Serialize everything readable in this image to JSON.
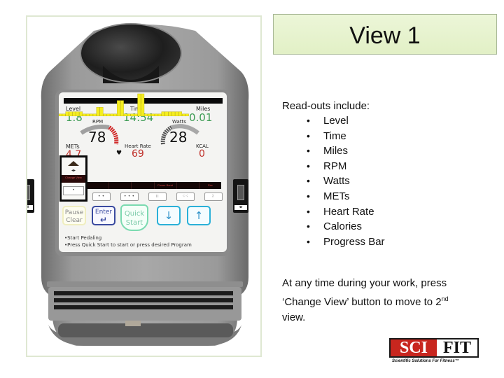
{
  "slide": {
    "title": "View 1",
    "readouts_heading": "Read-outs include:",
    "readouts": [
      "Level",
      "Time",
      "Miles",
      "RPM",
      "Watts",
      "METs",
      "Heart Rate",
      "Calories",
      "Progress Bar"
    ],
    "bullet": "•",
    "note": {
      "part1": "At any time during your work, press ‘Change View’ button to move to 2",
      "superscript": "nd",
      "part2": " view."
    },
    "logo": {
      "sci": "SCI",
      "fit": "FIT",
      "tagline": "Scientific Solutions For Fitness™"
    }
  },
  "console": {
    "screen": {
      "level": {
        "label": "Level",
        "value": "1.8"
      },
      "time": {
        "label": "Time",
        "value": "14:54"
      },
      "miles": {
        "label": "Miles",
        "value": "0.01"
      },
      "rpm": {
        "label": "RPM",
        "value": "78",
        "fraction": 0.75
      },
      "watts": {
        "label": "Watts",
        "value": "28",
        "fraction": 0.35
      },
      "mets": {
        "label": "METs",
        "value": "4.7"
      },
      "heart_rate": {
        "label": "Heart Rate",
        "value": "69",
        "icon": "♥"
      },
      "kcal": {
        "label": "KCAL",
        "value": "0"
      },
      "progress_profile": [
        1,
        1,
        2,
        2,
        2,
        2,
        2,
        1,
        1,
        1,
        1,
        4,
        4,
        1,
        1,
        1,
        1,
        7,
        7,
        1,
        1,
        1,
        1,
        10,
        10,
        1,
        1,
        1,
        1,
        1,
        2,
        2,
        2,
        2,
        2,
        2,
        1,
        1
      ],
      "progress_completed": 0.02,
      "segments": [
        "",
        "",
        "",
        "Power Burst",
        "",
        "Fire"
      ],
      "level_keys": [
        "•",
        "• •",
        "• • •",
        "∷",
        "⁖⁖",
        "⁙"
      ],
      "change_view": {
        "label": "Change View",
        "arrow": "◂▸",
        "key": "•"
      }
    },
    "buttons": {
      "pause_line1": "Pause",
      "pause_line2": "Clear",
      "enter": "Enter",
      "enter_icon": "↵",
      "quick_line1": "Quick",
      "quick_line2": "Start",
      "down": "↓",
      "up": "↑"
    },
    "instructions": [
      "•Start Pedaling",
      "•Press Quick Start to start or press desired Program"
    ],
    "left_port_tag": "iFit",
    "right_port_tag": "◂▸"
  }
}
